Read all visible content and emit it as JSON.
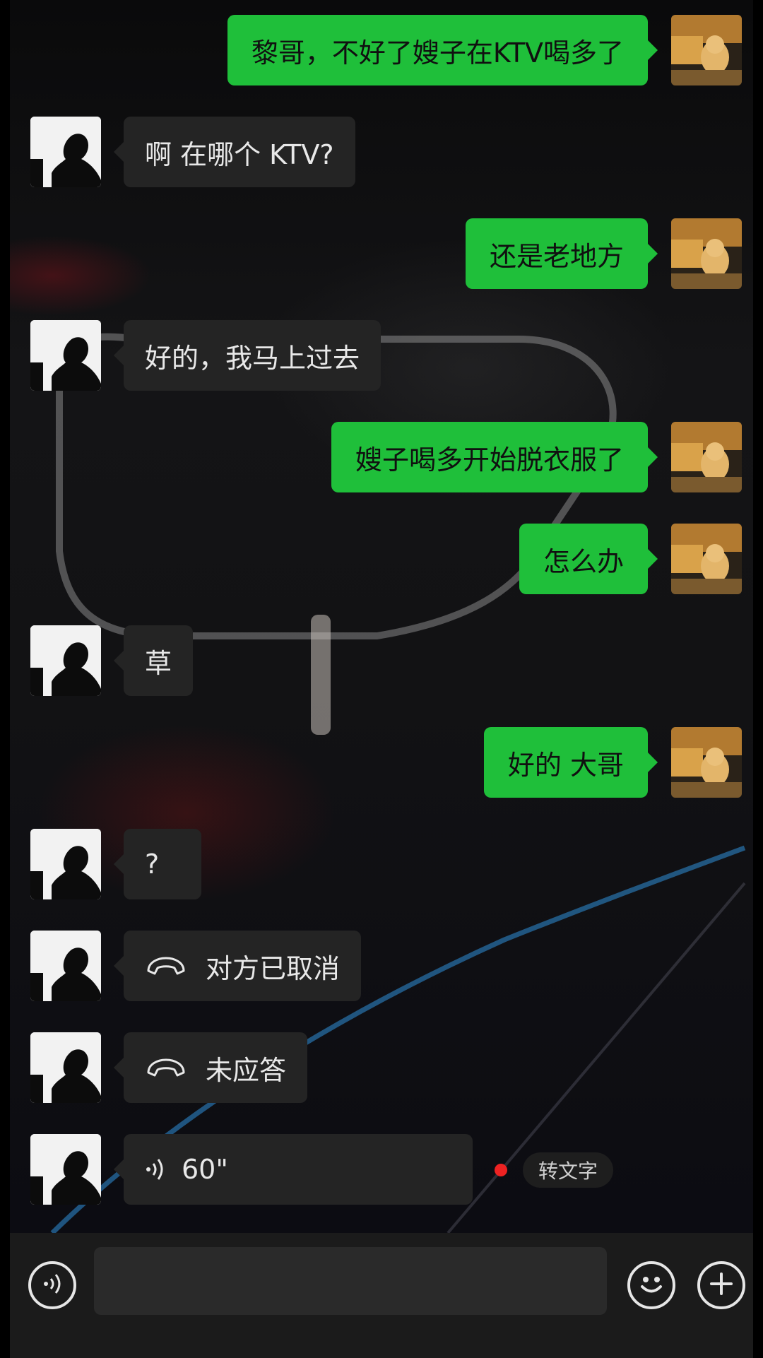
{
  "messages": [
    {
      "from": "me",
      "text": "黎哥，不好了嫂子在KTV喝多了"
    },
    {
      "from": "them",
      "text": "啊 在哪个 KTV?"
    },
    {
      "from": "me",
      "text": "还是老地方"
    },
    {
      "from": "them",
      "text": "好的，我马上过去"
    },
    {
      "from": "me",
      "text": "嫂子喝多开始脱衣服了"
    },
    {
      "from": "me",
      "text": "怎么办"
    },
    {
      "from": "them",
      "text": "草"
    },
    {
      "from": "me",
      "text": "好的 大哥"
    },
    {
      "from": "them",
      "text": "?"
    },
    {
      "from": "them",
      "type": "call",
      "icon": "phone-hangup-icon",
      "text": "对方已取消"
    },
    {
      "from": "them",
      "type": "call",
      "icon": "phone-hangup-icon",
      "text": "未应答"
    },
    {
      "from": "them",
      "type": "voice",
      "icon": "voice-wave-icon",
      "duration": "60\"",
      "unread": true,
      "to_text_label": "转文字"
    }
  ],
  "input_bar": {
    "voice_toggle_icon": "voice-mode-icon",
    "input_value": "",
    "emoji_icon": "emoji-icon",
    "more_icon": "plus-icon"
  },
  "colors": {
    "outgoing_bubble": "#1fbf3a",
    "incoming_bubble": "#242424",
    "unread_dot": "#ee2222",
    "input_bar": "#1b1b1b"
  }
}
